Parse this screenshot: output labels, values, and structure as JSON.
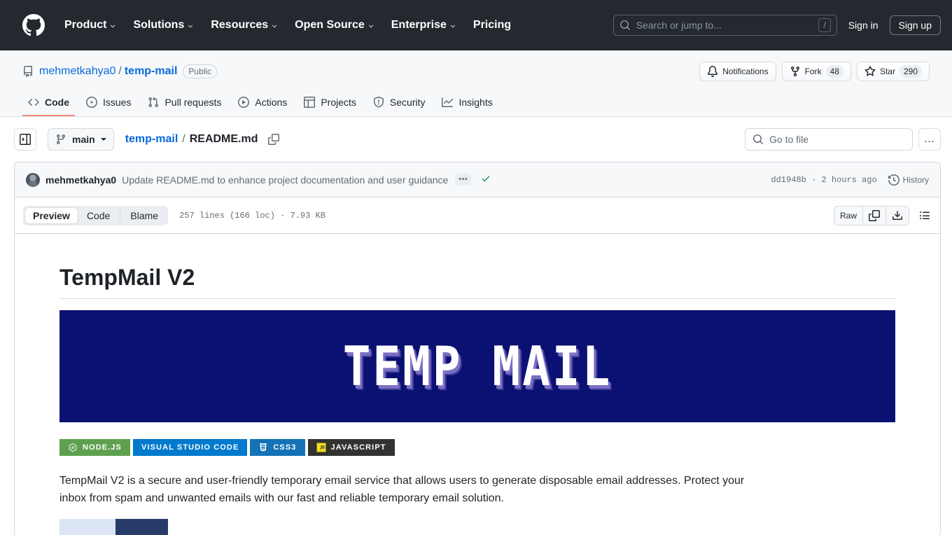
{
  "global_header": {
    "logo_icon": "github-mark-icon",
    "nav": [
      {
        "label": "Product",
        "has_dropdown": true
      },
      {
        "label": "Solutions",
        "has_dropdown": true
      },
      {
        "label": "Resources",
        "has_dropdown": true
      },
      {
        "label": "Open Source",
        "has_dropdown": true
      },
      {
        "label": "Enterprise",
        "has_dropdown": true
      },
      {
        "label": "Pricing",
        "has_dropdown": false
      }
    ],
    "search": {
      "icon": "search-icon",
      "placeholder": "Search or jump to...",
      "value": "",
      "shortcut": "/"
    },
    "sign_in": "Sign in",
    "sign_up": "Sign up",
    "background": "#24292f"
  },
  "repo": {
    "icon": "repo-icon",
    "owner": "mehmetkahya0",
    "separator": "/",
    "name": "temp-mail",
    "visibility": "Public",
    "actions": [
      {
        "name": "notifications",
        "icon": "bell-icon",
        "label": "Notifications",
        "count": null
      },
      {
        "name": "fork",
        "icon": "fork-icon",
        "label": "Fork",
        "count": "48"
      },
      {
        "name": "star",
        "icon": "star-icon",
        "label": "Star",
        "count": "290"
      }
    ],
    "tabs": [
      {
        "label": "Code",
        "icon": "code-icon",
        "active": true
      },
      {
        "label": "Issues",
        "icon": "issue-opened-icon",
        "active": false
      },
      {
        "label": "Pull requests",
        "icon": "git-pull-request-icon",
        "active": false
      },
      {
        "label": "Actions",
        "icon": "play-icon",
        "active": false
      },
      {
        "label": "Projects",
        "icon": "table-icon",
        "active": false
      },
      {
        "label": "Security",
        "icon": "shield-icon",
        "active": false
      },
      {
        "label": "Insights",
        "icon": "graph-icon",
        "active": false
      }
    ],
    "active_tab_color": "#fd8c73"
  },
  "file_nav": {
    "sidebar_toggle_icon": "sidebar-expand-icon",
    "branch": {
      "icon": "git-branch-icon",
      "label": "main"
    },
    "breadcrumb": {
      "root": "temp-mail",
      "separator": "/",
      "current": "README.md",
      "copy_icon": "copy-path-icon"
    },
    "go_to_file": {
      "icon": "search-icon",
      "placeholder": "Go to file",
      "value": ""
    },
    "more_menu": "…"
  },
  "commit": {
    "avatar": "author-avatar",
    "author": "mehmetkahya0",
    "message": "Update README.md to enhance project documentation and user guidance",
    "expand_label": "•••",
    "status_icon": "check-icon",
    "status_color": "#1a7f37",
    "sha": "dd1948b",
    "sha_separator": "·",
    "relative_time": "2 hours ago",
    "history": {
      "icon": "history-icon",
      "label": "History"
    }
  },
  "file_toolbar": {
    "view_modes": [
      {
        "label": "Preview",
        "active": true
      },
      {
        "label": "Code",
        "active": false
      },
      {
        "label": "Blame",
        "active": false
      }
    ],
    "file_meta": "257 lines (166 loc) · 7.93 KB",
    "raw_label": "Raw",
    "copy_icon": "copy-icon",
    "download_icon": "download-icon",
    "outline_icon": "outline-list-icon"
  },
  "readme": {
    "heading": "TempMail V2",
    "banner": {
      "text": "TEMP MAIL",
      "background": "#0a1172",
      "text_color": "#ffffff",
      "shadow_color": "#7b6fc4"
    },
    "badges": [
      {
        "label": "NODE.JS",
        "icon": "nodejs-icon",
        "bg": "#5fa04e",
        "fg": "#ffffff"
      },
      {
        "label": "VISUAL STUDIO CODE",
        "icon": null,
        "bg": "#007acc",
        "fg": "#ffffff"
      },
      {
        "label": "CSS3",
        "icon": "css3-icon",
        "bg": "#1572b6",
        "fg": "#ffffff"
      },
      {
        "label": "JAVASCRIPT",
        "icon": "javascript-icon",
        "bg": "#323330",
        "fg": "#ffffff"
      }
    ],
    "description": "TempMail V2 is a secure and user-friendly temporary email service that allows users to generate disposable email addresses. Protect your inbox from spam and unwanted emails with our fast and reliable temporary email solution."
  }
}
